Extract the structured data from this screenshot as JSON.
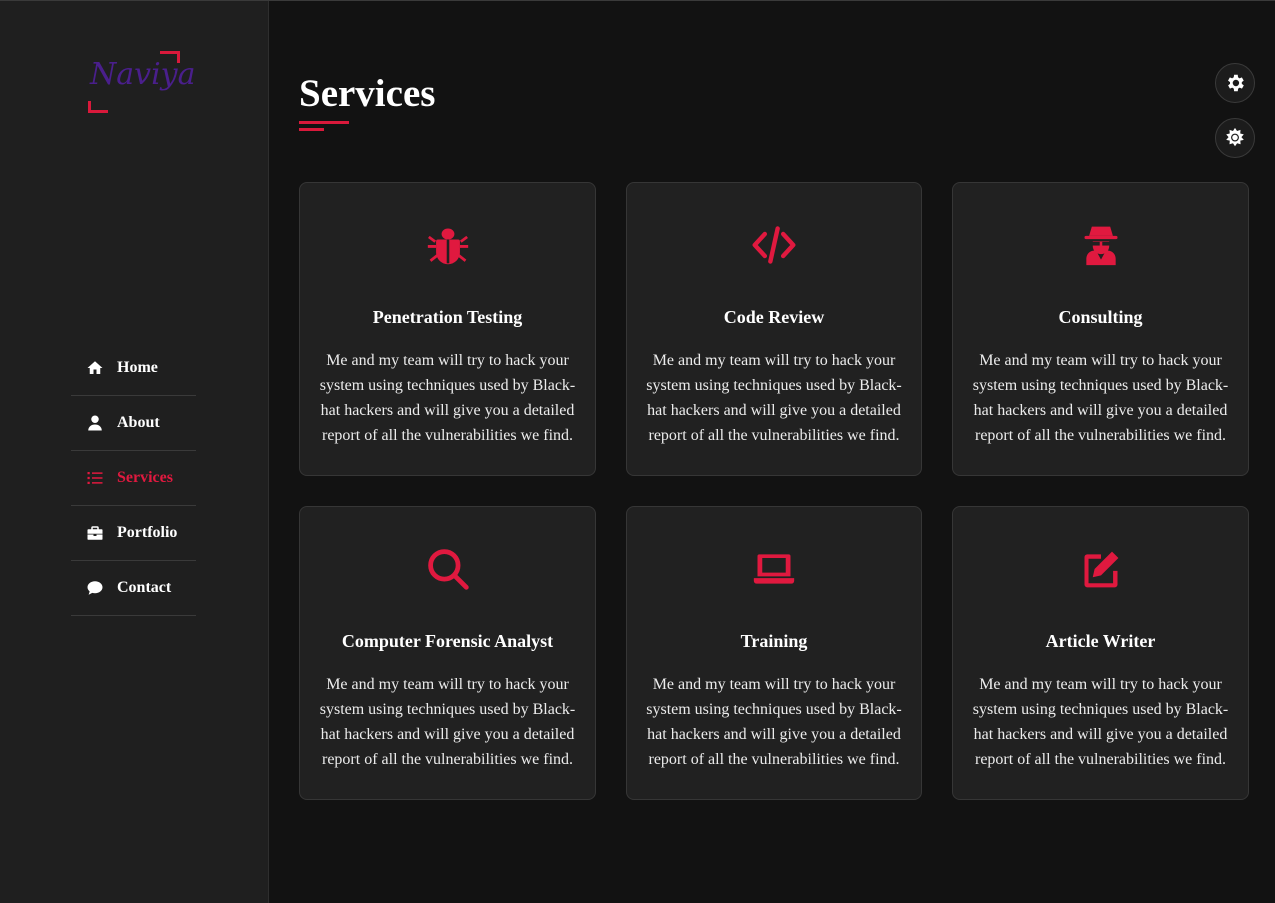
{
  "brand": {
    "logo_text": "Naviya",
    "accent_color": "#d9193b",
    "logo_color": "#4a1f8c"
  },
  "nav": {
    "items": [
      {
        "label": "Home",
        "icon": "home-icon"
      },
      {
        "label": "About",
        "icon": "user-icon"
      },
      {
        "label": "Services",
        "icon": "list-icon",
        "active": true
      },
      {
        "label": "Portfolio",
        "icon": "briefcase-icon"
      },
      {
        "label": "Contact",
        "icon": "chat-bubble-icon"
      }
    ]
  },
  "page": {
    "title": "Services"
  },
  "controls": [
    {
      "icon": "gear-icon"
    },
    {
      "icon": "sun-icon"
    }
  ],
  "services": [
    {
      "title": "Penetration Testing",
      "icon": "bug-icon",
      "description": "Me and my team will try to hack your system using techniques used by Black-hat hackers and will give you a detailed report of all the vulnerabilities we find."
    },
    {
      "title": "Code Review",
      "icon": "code-icon",
      "description": "Me and my team will try to hack your system using techniques used by Black-hat hackers and will give you a detailed report of all the vulnerabilities we find."
    },
    {
      "title": "Consulting",
      "icon": "spy-icon",
      "description": "Me and my team will try to hack your system using techniques used by Black-hat hackers and will give you a detailed report of all the vulnerabilities we find."
    },
    {
      "title": "Computer Forensic Analyst",
      "icon": "search-icon",
      "description": "Me and my team will try to hack your system using techniques used by Black-hat hackers and will give you a detailed report of all the vulnerabilities we find."
    },
    {
      "title": "Training",
      "icon": "laptop-icon",
      "description": "Me and my team will try to hack your system using techniques used by Black-hat hackers and will give you a detailed report of all the vulnerabilities we find."
    },
    {
      "title": "Article Writer",
      "icon": "edit-icon",
      "description": "Me and my team will try to hack your system using techniques used by Black-hat hackers and will give you a detailed report of all the vulnerabilities we find."
    }
  ]
}
